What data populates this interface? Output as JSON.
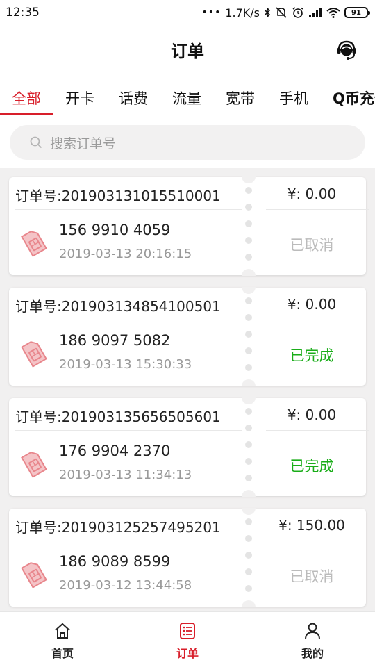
{
  "status_bar": {
    "time": "12:35",
    "dots": "•••",
    "network_speed": "1.7K/s",
    "battery": "91",
    "icons": [
      "bluetooth-icon",
      "mute-icon",
      "alarm-icon",
      "signal-icon",
      "wifi-icon",
      "battery-icon"
    ]
  },
  "header": {
    "title": "订单",
    "service_icon": "customer-service-icon"
  },
  "tabs": [
    {
      "label": "全部",
      "active": true
    },
    {
      "label": "开卡"
    },
    {
      "label": "话费"
    },
    {
      "label": "流量"
    },
    {
      "label": "宽带"
    },
    {
      "label": "手机"
    },
    {
      "label": "Q币充值"
    }
  ],
  "search": {
    "placeholder": "搜索订单号"
  },
  "orders": [
    {
      "order_no": "订单号:201903131015510001",
      "phone": "156 9910 4059",
      "time": "2019-03-13 20:16:15",
      "price": "¥:  0.00",
      "status": "已取消",
      "status_type": "cancel"
    },
    {
      "order_no": "订单号:201903134854100501",
      "phone": "186 9097 5082",
      "time": "2019-03-13 15:30:33",
      "price": "¥:  0.00",
      "status": "已完成",
      "status_type": "done"
    },
    {
      "order_no": "订单号:201903135656505601",
      "phone": "176 9904 2370",
      "time": "2019-03-13 11:34:13",
      "price": "¥:  0.00",
      "status": "已完成",
      "status_type": "done"
    },
    {
      "order_no": "订单号:201903125257495201",
      "phone": "186 9089 8599",
      "time": "2019-03-12 13:44:58",
      "price": "¥:  150.00",
      "status": "已取消",
      "status_type": "cancel"
    }
  ],
  "bottom_nav": [
    {
      "label": "首页",
      "icon": "home-icon"
    },
    {
      "label": "订单",
      "icon": "order-list-icon",
      "active": true
    },
    {
      "label": "我的",
      "icon": "user-icon"
    }
  ],
  "colors": {
    "accent": "#d81e2a",
    "done": "#1aad19",
    "cancel": "#bbbbbb",
    "background": "#f1f0f0"
  }
}
